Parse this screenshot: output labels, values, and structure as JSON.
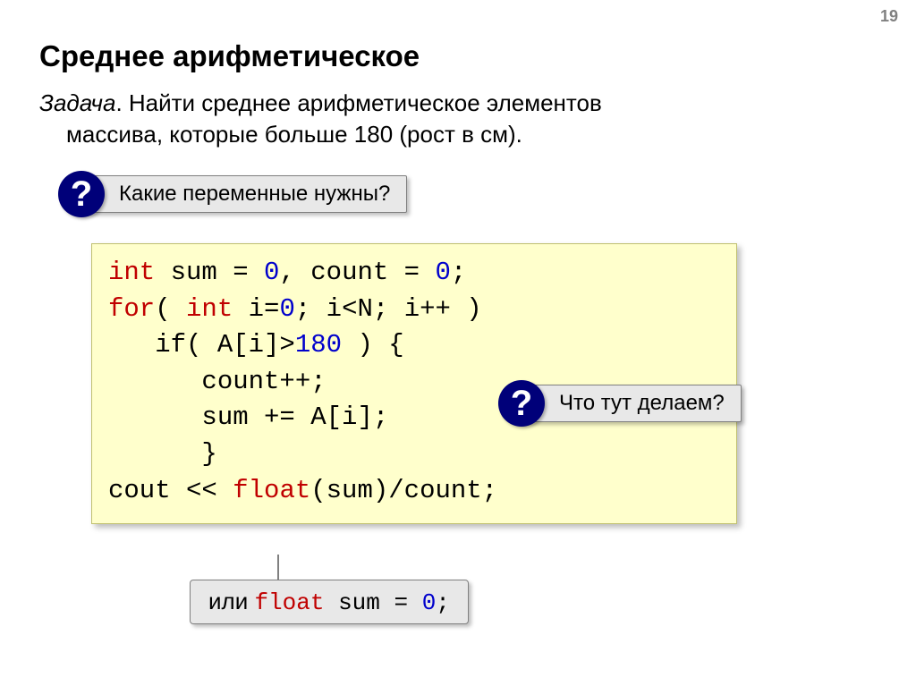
{
  "page_number": "19",
  "title": "Среднее арифметическое",
  "problem": {
    "label": "Задача",
    "sep": ". ",
    "line1": "Найти среднее арифметическое элементов",
    "line2": "массива, которые больше 180 (рост в см)."
  },
  "callout1": "Какие переменные нужны?",
  "callout2": "Что тут делаем?",
  "code": {
    "int": "int",
    "for": "for",
    "float": "float",
    "l1a": " sum = ",
    "l1b": "0",
    "l1c": ", count = ",
    "l1d": "0",
    "l1e": ";",
    "l2a": "( ",
    "l2b": " i=",
    "l2c": "0",
    "l2d": "; i<N; i++ )",
    "l3a": "   if( A[i]>",
    "l3b": "180",
    "l3c": " ) {",
    "l4": "      count++;",
    "l5": "      sum += A[i];",
    "l6": "      }",
    "l7a": "cout << ",
    "l7b": "(sum)/count;"
  },
  "callout3": {
    "prefix": "или ",
    "code": " sum = ",
    "zero": "0",
    "semi": ";"
  },
  "qmark": "?"
}
